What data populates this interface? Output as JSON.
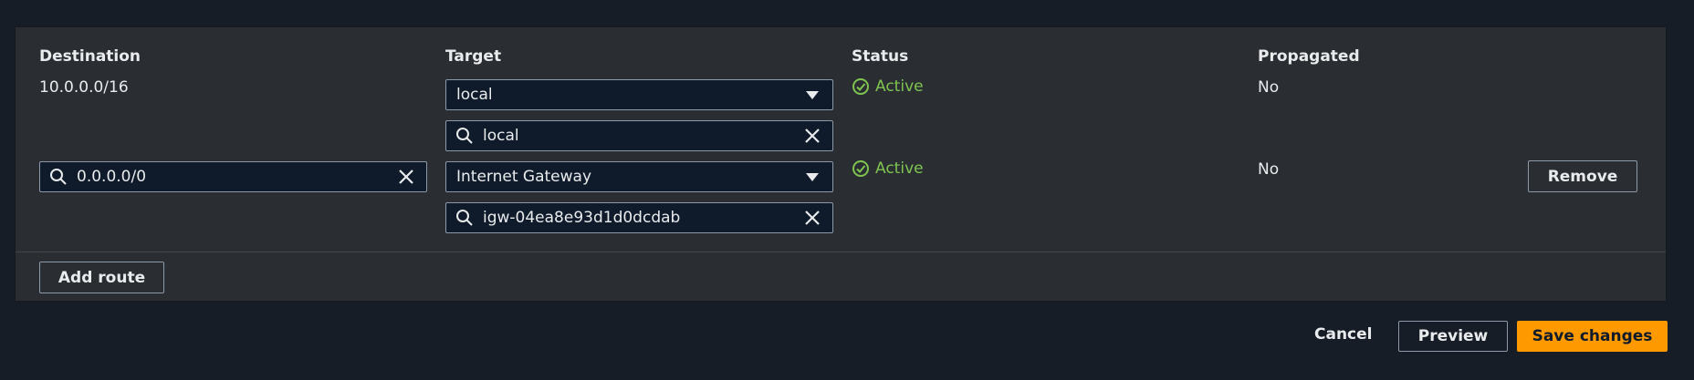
{
  "table": {
    "headers": {
      "destination": "Destination",
      "target": "Target",
      "status": "Status",
      "propagated": "Propagated"
    },
    "rows": [
      {
        "destination": "10.0.0.0/16",
        "target_select": "local",
        "target_search": "local",
        "status": "Active",
        "propagated": "No"
      },
      {
        "destination": "0.0.0.0/0",
        "target_select": "Internet Gateway",
        "target_search": "igw-04ea8e93d1d0dcdab",
        "status": "Active",
        "propagated": "No",
        "remove_label": "Remove"
      }
    ]
  },
  "actions": {
    "add_route": "Add route",
    "cancel": "Cancel",
    "preview": "Preview",
    "save": "Save changes"
  },
  "colors": {
    "background": "#161d26",
    "panel": "#2a2e33",
    "status_active": "#7fc44f",
    "primary": "#ff9900"
  }
}
